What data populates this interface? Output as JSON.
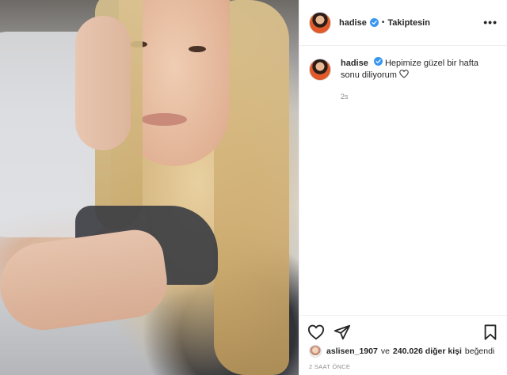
{
  "post": {
    "author": "hadise",
    "follow_status": "Takiptesin",
    "more_icon": "•••",
    "separator": "•",
    "caption_author": "hadise",
    "caption": "Hepimize güzel bir hafta sonu diliyorum",
    "time_ago": "2s",
    "liked_by_user": "aslisen_1907",
    "liked_joiner": "ve",
    "liked_others_count": "240.026 diğer kişi",
    "liked_suffix": "beğendi",
    "posted_label": "2 SAAT ÖNCE"
  },
  "icons": {
    "verified": "verified-badge-icon",
    "like": "heart-icon",
    "share": "paper-plane-icon",
    "save": "bookmark-icon",
    "caption_emoji": "heart-icon"
  },
  "colors": {
    "verified": "#3897f0",
    "muted_text": "#8e8e8e",
    "text": "#262626",
    "border": "#efefef"
  }
}
